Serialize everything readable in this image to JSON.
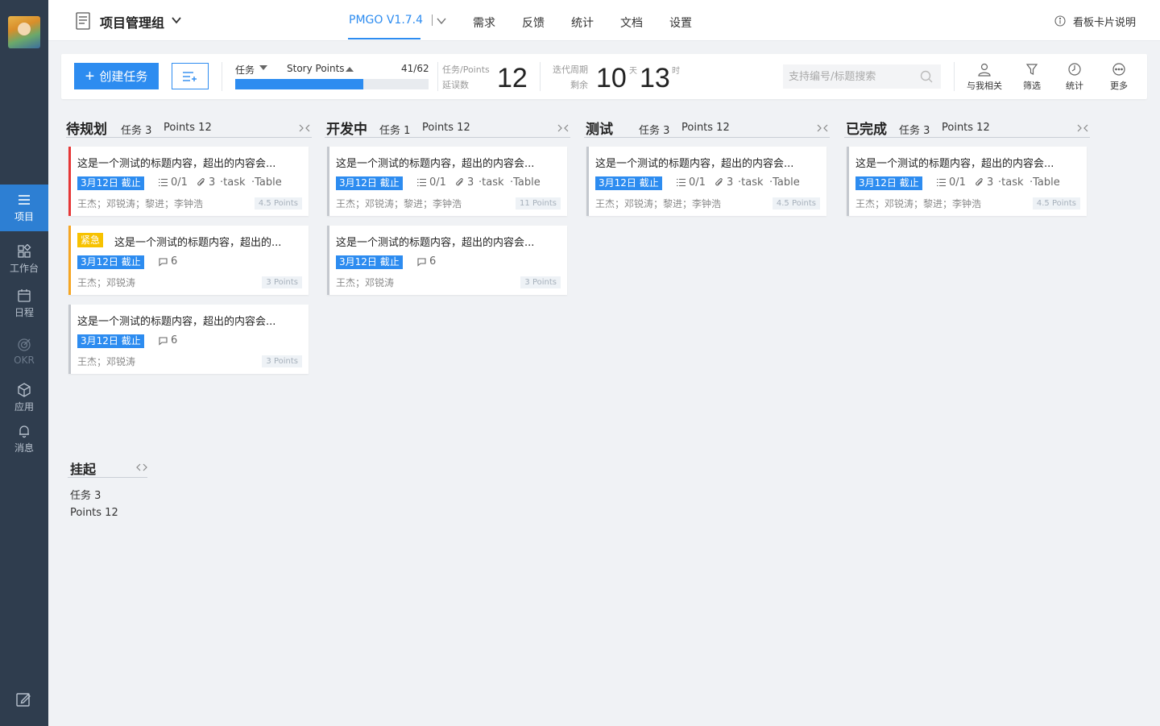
{
  "sidebar": {
    "items": [
      {
        "label": "项目",
        "icon": "project-icon"
      },
      {
        "label": "工作台",
        "icon": "workbench-icon"
      },
      {
        "label": "日程",
        "icon": "calendar-icon"
      },
      {
        "label": "OKR",
        "icon": "okr-icon"
      },
      {
        "label": "应用",
        "icon": "cube-icon"
      },
      {
        "label": "消息",
        "icon": "bell-icon"
      }
    ]
  },
  "topbar": {
    "project_title": "项目管理组",
    "version": "PMGO V1.7.4",
    "nav": [
      "需求",
      "反馈",
      "统计",
      "文档",
      "设置"
    ],
    "help_text": "看板卡片说明"
  },
  "toolbar": {
    "create_label": "创建任务",
    "select_task": "任务",
    "select_points": "Story Points",
    "progress_text": "41/62",
    "progress_fraction": 0.661,
    "tasks_points_label": "任务/Points",
    "delay_label": "延误数",
    "delay_value": "12",
    "iter_label": "迭代周期",
    "remaining_label": "剩余",
    "days_value": "10",
    "days_unit": "天",
    "hours_value": "13",
    "hours_unit": "时",
    "search_placeholder": "支持编号/标题搜索",
    "tools": [
      {
        "label": "与我相关",
        "icon": "user-icon"
      },
      {
        "label": "筛选",
        "icon": "filter-icon"
      },
      {
        "label": "统计",
        "icon": "clock-icon"
      },
      {
        "label": "更多",
        "icon": "more-icon"
      }
    ]
  },
  "columns": [
    {
      "title": "待规划",
      "tasks": "任务 3",
      "points": "Points 12",
      "cards": [
        {
          "title": "这是一个测试的标题内容，超出的内容会...",
          "urgent": "",
          "due": "3月12日 截止",
          "checklist": "0/1",
          "attachments": "3",
          "tag1": "·task",
          "tag2": "·Table",
          "comments": "",
          "people": "王杰；邓锐涛；黎进；李钟浩",
          "points": "4.5 Points",
          "accent": "red"
        },
        {
          "title": "这是一个测试的标题内容，超出的...",
          "urgent": "紧急",
          "due": "3月12日 截止",
          "checklist": "",
          "attachments": "",
          "tag1": "",
          "tag2": "",
          "comments": "6",
          "people": "王杰；邓锐涛",
          "points": "3 Points",
          "accent": "orange"
        },
        {
          "title": "这是一个测试的标题内容，超出的内容会...",
          "urgent": "",
          "due": "3月12日 截止",
          "checklist": "",
          "attachments": "",
          "tag1": "",
          "tag2": "",
          "comments": "6",
          "people": "王杰；邓锐涛",
          "points": "3 Points",
          "accent": "gray"
        }
      ]
    },
    {
      "title": "开发中",
      "tasks": "任务 1",
      "points": "Points 12",
      "cards": [
        {
          "title": "这是一个测试的标题内容，超出的内容会...",
          "urgent": "",
          "due": "3月12日 截止",
          "checklist": "0/1",
          "attachments": "3",
          "tag1": "·task",
          "tag2": "·Table",
          "comments": "",
          "people": "王杰；邓锐涛；黎进；李钟浩",
          "points": "11 Points",
          "accent": "gray"
        },
        {
          "title": "这是一个测试的标题内容，超出的内容会...",
          "urgent": "",
          "due": "3月12日 截止",
          "checklist": "",
          "attachments": "",
          "tag1": "",
          "tag2": "",
          "comments": "6",
          "people": "王杰；邓锐涛",
          "points": "3 Points",
          "accent": "gray"
        }
      ]
    },
    {
      "title": "测试",
      "tasks": "任务 3",
      "points": "Points 12",
      "cards": [
        {
          "title": "这是一个测试的标题内容，超出的内容会...",
          "urgent": "",
          "due": "3月12日 截止",
          "checklist": "0/1",
          "attachments": "3",
          "tag1": "·task",
          "tag2": "·Table",
          "comments": "",
          "people": "王杰；邓锐涛；黎进；李钟浩",
          "points": "4.5 Points",
          "accent": "gray"
        }
      ]
    },
    {
      "title": "已完成",
      "tasks": "任务 3",
      "points": "Points 12",
      "cards": [
        {
          "title": "这是一个测试的标题内容，超出的内容会...",
          "urgent": "",
          "due": "3月12日 截止",
          "checklist": "0/1",
          "attachments": "3",
          "tag1": "·task",
          "tag2": "·Table",
          "comments": "",
          "people": "王杰；邓锐涛；黎进；李钟浩",
          "points": "4.5 Points",
          "accent": "gray"
        }
      ]
    }
  ],
  "suspended": {
    "title": "挂起",
    "tasks": "任务 3",
    "points": "Points 12"
  },
  "colors": {
    "accent": "#2d8cf0",
    "sidebar_bg": "#2f3d4e",
    "urgent": "#f7c200",
    "red_flag": "#e63737",
    "orange_flag": "#f5a623"
  }
}
